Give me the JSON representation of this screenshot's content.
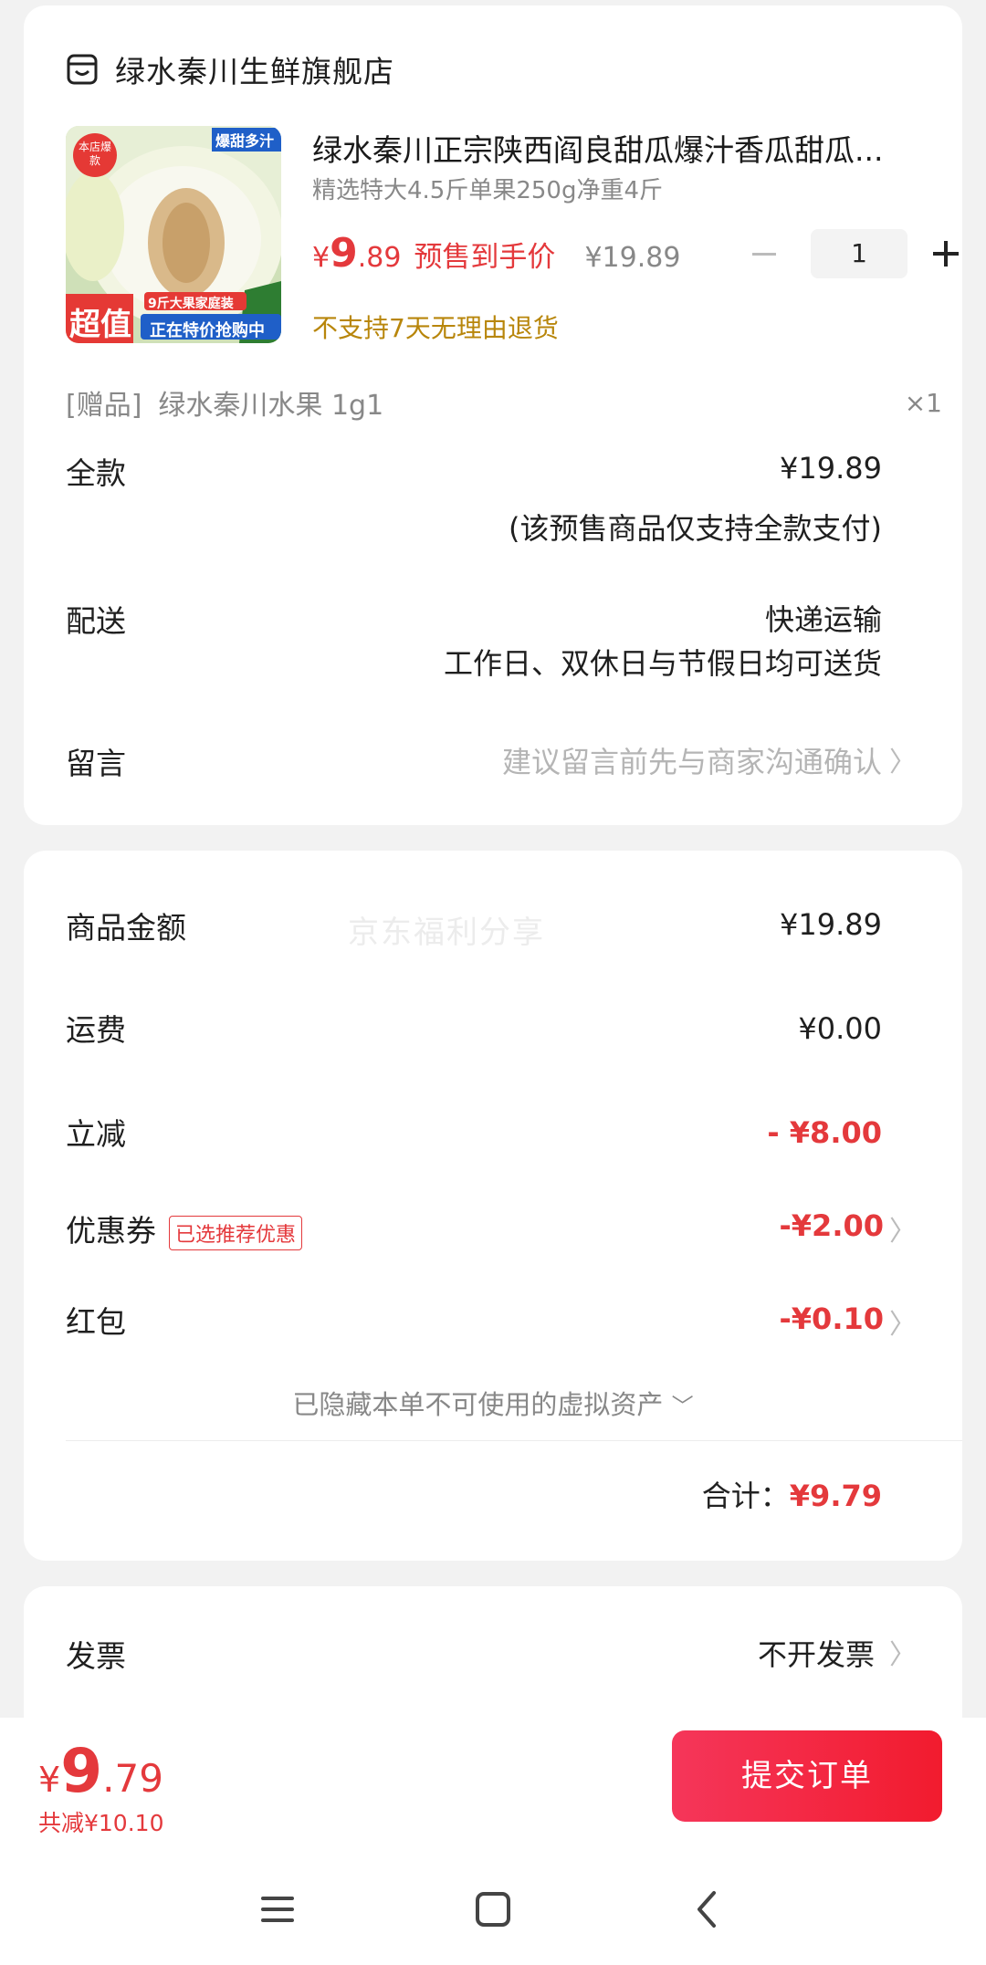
{
  "shop": {
    "name": "绿水秦川生鲜旗舰店",
    "icon": "store-icon"
  },
  "product": {
    "title": "绿水秦川正宗陕西阎良甜瓜爆汁香瓜甜瓜...",
    "spec": "精选特大4.5斤单果250g净重4斤",
    "price_symbol": "¥",
    "price_int": "9",
    "price_dec": ".89",
    "presale_label": "预售到手价",
    "original_price": "¥19.89",
    "quantity": "1",
    "no_return": "不支持7天无理由退货",
    "image": {
      "badge_top": "爆甜多汁",
      "seal": "本店爆款",
      "big_label": "超值",
      "pack_label": "9斤大果家庭装",
      "promo_label": "正在特价抢购中"
    }
  },
  "gift": {
    "tag": "[赠品]",
    "name": "绿水秦川水果 1g1",
    "qty": "×1"
  },
  "payment": {
    "label": "全款",
    "value": "¥19.89",
    "note": "(该预售商品仅支持全款支付)"
  },
  "delivery": {
    "label": "配送",
    "method": "快递运输",
    "note": "工作日、双休日与节假日均可送货"
  },
  "message": {
    "label": "留言",
    "placeholder": "建议留言前先与商家沟通确认"
  },
  "summary": {
    "watermark": "京东福利分享",
    "goods_label": "商品金额",
    "goods_value": "¥19.89",
    "shipping_label": "运费",
    "shipping_value": "¥0.00",
    "discount_label": "立减",
    "discount_value": "- ¥8.00",
    "coupon_label": "优惠券",
    "coupon_badge": "已选推荐优惠",
    "coupon_value": "-¥2.00",
    "redpacket_label": "红包",
    "redpacket_value": "-¥0.10",
    "hidden_note": "已隐藏本单不可使用的虚拟资产",
    "total_label": "合计：",
    "total_value": "¥9.79"
  },
  "invoice": {
    "label": "发票",
    "value": "不开发票"
  },
  "bottom": {
    "price_symbol": "¥",
    "price_int": "9",
    "price_dec": ".79",
    "saved": "共减¥10.10",
    "submit_label": "提交订单"
  },
  "colors": {
    "accent": "#e4393c",
    "warning": "#b8860b",
    "background": "#f2f2f2"
  }
}
